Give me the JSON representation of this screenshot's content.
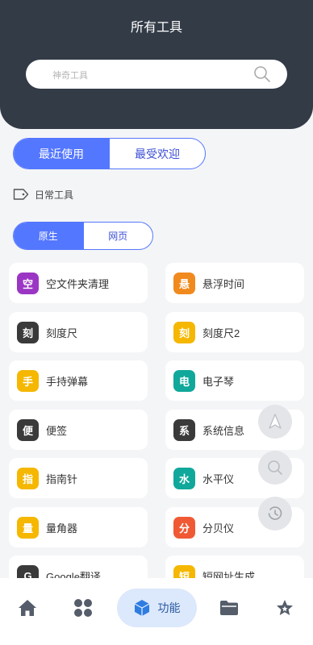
{
  "header": {
    "title": "所有工具"
  },
  "search": {
    "placeholder": "神奇工具"
  },
  "tabs": {
    "recent": "最近使用",
    "popular": "最受欢迎"
  },
  "section": {
    "label": "日常工具"
  },
  "subtabs": {
    "native": "原生",
    "web": "网页"
  },
  "tools": [
    {
      "badge": "空",
      "label": "空文件夹清理",
      "color": "#9b36c4"
    },
    {
      "badge": "悬",
      "label": "悬浮时间",
      "color": "#f08a1e"
    },
    {
      "badge": "刻",
      "label": "刻度尺",
      "color": "#3a3a3a"
    },
    {
      "badge": "刻",
      "label": "刻度尺2",
      "color": "#f5b700"
    },
    {
      "badge": "手",
      "label": "手持弹幕",
      "color": "#f5b700"
    },
    {
      "badge": "电",
      "label": "电子琴",
      "color": "#10a89a"
    },
    {
      "badge": "便",
      "label": "便签",
      "color": "#3a3a3a"
    },
    {
      "badge": "系",
      "label": "系统信息",
      "color": "#3a3a3a"
    },
    {
      "badge": "指",
      "label": "指南针",
      "color": "#f5b700"
    },
    {
      "badge": "水",
      "label": "水平仪",
      "color": "#10a89a"
    },
    {
      "badge": "量",
      "label": "量角器",
      "color": "#f5b700"
    },
    {
      "badge": "分",
      "label": "分贝仪",
      "color": "#ef5a34"
    },
    {
      "badge": "G",
      "label": "Google翻译",
      "color": "#3a3a3a"
    },
    {
      "badge": "短",
      "label": "短网址生成",
      "color": "#f5b700"
    }
  ],
  "nav": {
    "active_label": "功能"
  },
  "colors": {
    "accent": "#5477ff",
    "header_bg": "#333b47",
    "nav_active_bg": "#dce8fb"
  }
}
